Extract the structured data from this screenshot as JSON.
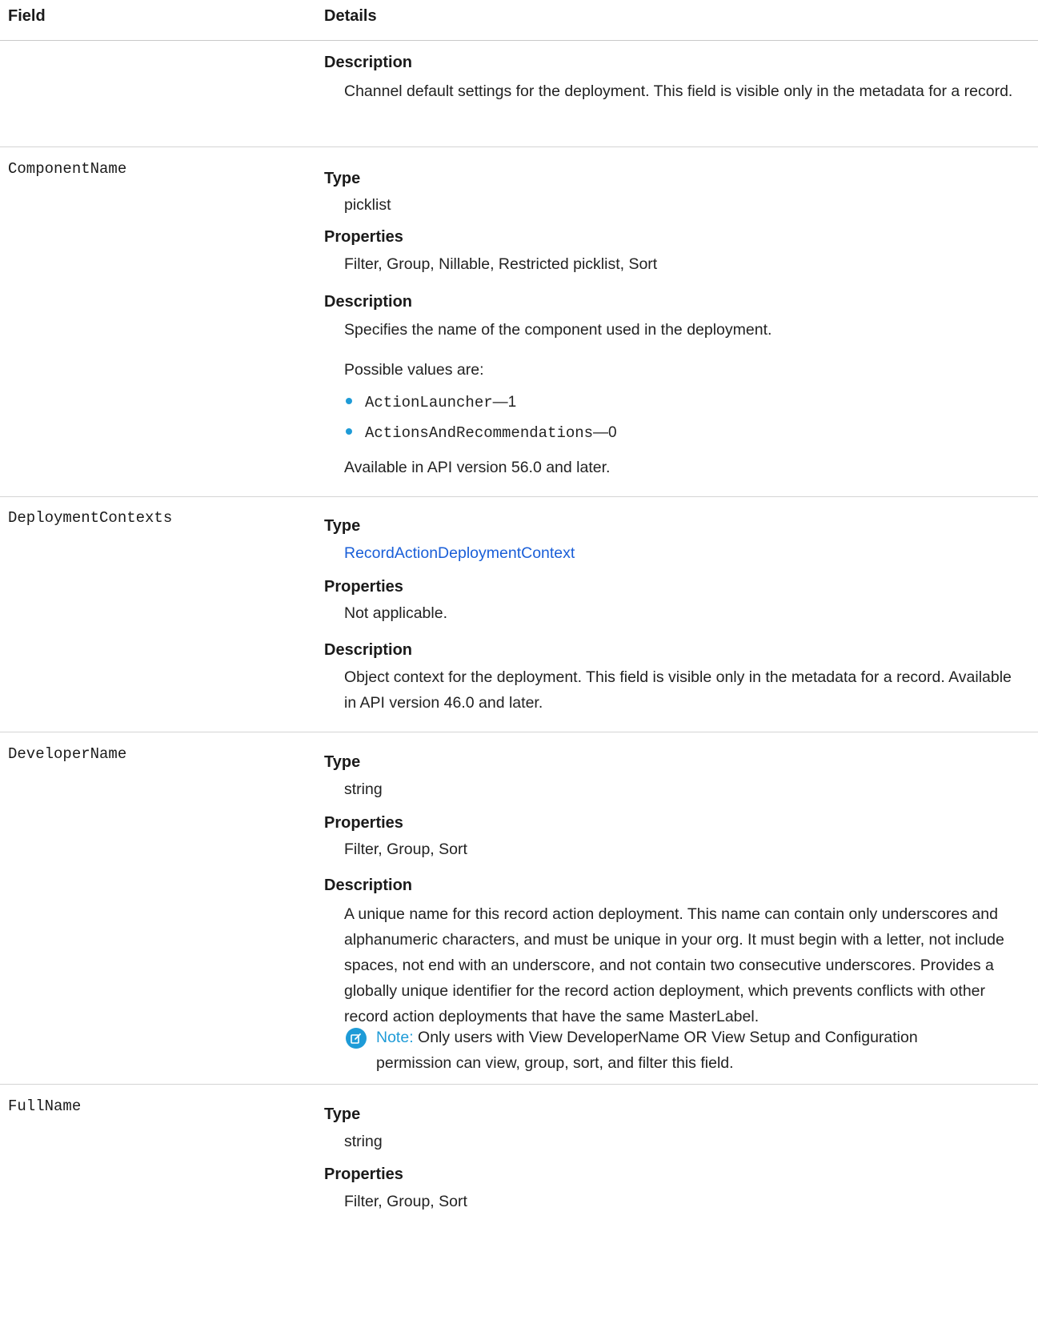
{
  "table": {
    "headers": {
      "field": "Field",
      "details": "Details"
    },
    "labels": {
      "type": "Type",
      "properties": "Properties",
      "description": "Description"
    },
    "row0": {
      "description": "Channel default settings for the deployment. This field is visible only in the metadata for a record."
    },
    "row1": {
      "field": "ComponentName",
      "type": "picklist",
      "properties": "Filter, Group, Nillable, Restricted picklist, Sort",
      "description": "Specifies the name of the component used in the deployment.",
      "possible_values_label": "Possible values are:",
      "values": [
        {
          "name": "ActionLauncher",
          "sep": "—",
          "num": "1"
        },
        {
          "name": "ActionsAndRecommendations",
          "sep": "—",
          "num": "0"
        }
      ],
      "availability": "Available in API version 56.0 and later."
    },
    "row2": {
      "field": "DeploymentContexts",
      "type": "RecordActionDeploymentContext",
      "properties": "Not applicable.",
      "description": "Object context for the deployment. This field is visible only in the metadata for a record. Available in API version 46.0 and later."
    },
    "row3": {
      "field": "DeveloperName",
      "type": "string",
      "properties": "Filter, Group, Sort",
      "description": "A unique name for this record action deployment. This name can contain only underscores and alphanumeric characters, and must be unique in your org. It must begin with a letter, not include spaces, not end with an underscore, and not contain two consecutive underscores. Provides a globally unique identifier for the record action deployment, which prevents conflicts with other record action deployments that have the same MasterLabel.",
      "note_label": "Note:",
      "note_text": "Only users with View DeveloperName OR View Setup and Configuration permission can view, group, sort, and filter this field."
    },
    "row4": {
      "field": "FullName",
      "type": "string",
      "properties": "Filter, Group, Sort"
    }
  },
  "colors": {
    "link": "#1a5fd8",
    "accent": "#1e9bd7",
    "rule": "#d4d4d4"
  }
}
